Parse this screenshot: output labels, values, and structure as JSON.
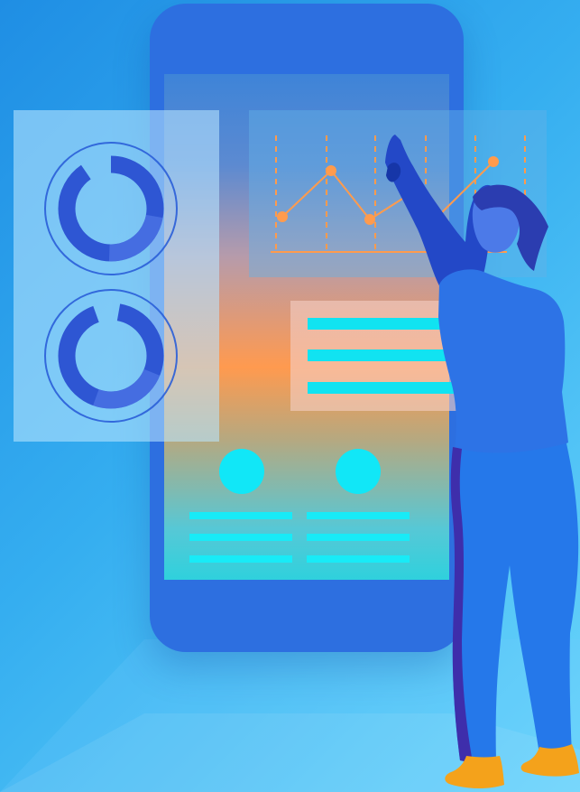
{
  "illustration": {
    "colors": {
      "background_start": "#1f8ee4",
      "background_end": "#6ad6fb",
      "phone": "#2d6fe0",
      "accent_cyan": "#11e3f1",
      "accent_orange": "#ff9a4f",
      "donut": "#2f56d8"
    },
    "elements": [
      "phone",
      "donut-progress-card",
      "line-chart-card",
      "text-bars-card",
      "person-pointing"
    ]
  }
}
